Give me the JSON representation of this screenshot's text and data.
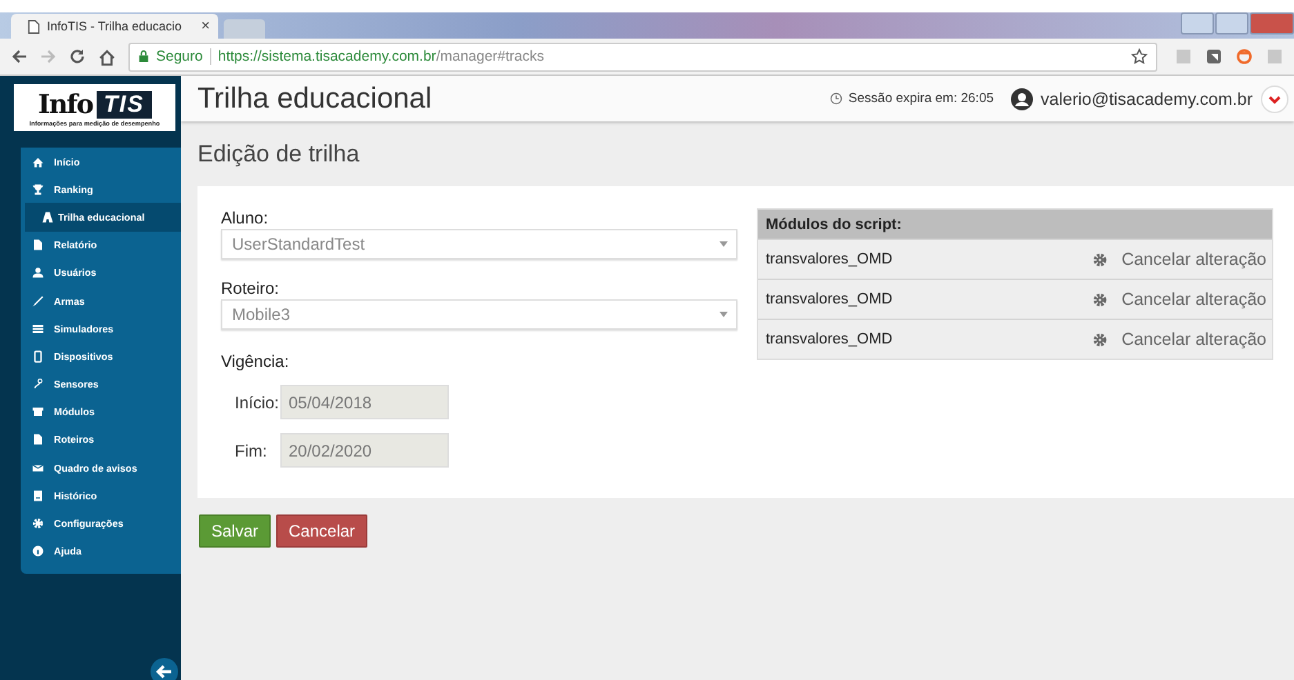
{
  "browser": {
    "tab": {
      "title": "InfoTIS - Trilha educacio",
      "close": "×"
    },
    "security": "Seguro",
    "url": {
      "host": "https://sistema.tisacademy.com.br",
      "path": "/manager#tracks"
    }
  },
  "sidebar": {
    "logo": {
      "word": "Info",
      "mark": "TIS",
      "tagline": "Informações para medição de desempenho"
    },
    "items": [
      {
        "label": "Início",
        "selected": false
      },
      {
        "label": "Ranking",
        "selected": false
      },
      {
        "label": "Trilha educacional",
        "selected": true
      },
      {
        "label": "Relatório",
        "selected": false
      },
      {
        "label": "Usuários",
        "selected": false
      },
      {
        "label": "Armas",
        "selected": false
      },
      {
        "label": "Simuladores",
        "selected": false
      },
      {
        "label": "Dispositivos",
        "selected": false
      },
      {
        "label": "Sensores",
        "selected": false
      },
      {
        "label": "Módulos",
        "selected": false
      },
      {
        "label": "Roteiros",
        "selected": false
      },
      {
        "label": "Quadro de avisos",
        "selected": false
      },
      {
        "label": "Histórico",
        "selected": false
      },
      {
        "label": "Configurações",
        "selected": false
      },
      {
        "label": "Ajuda",
        "selected": false
      }
    ]
  },
  "header": {
    "title": "Trilha educacional",
    "session": "Sessão expira em: 26:05",
    "user": "valerio@tisacademy.com.br"
  },
  "page_title": "Edição de trilha",
  "form": {
    "fields": [
      {
        "kind": "select",
        "label": "Aluno:",
        "value": "UserStandardTest"
      },
      {
        "kind": "select",
        "label": "Roteiro:",
        "value": "Mobile3"
      }
    ],
    "validity": {
      "label": "Vigência:",
      "dates": [
        {
          "label": "Início:",
          "value": "05/04/2018",
          "disabled": true
        },
        {
          "label": "Fim:",
          "value": "20/02/2020",
          "disabled": true
        }
      ]
    }
  },
  "modules": {
    "title": "Módulos do script:",
    "rows": [
      {
        "name": "transvalores_OMD",
        "action": "Cancelar alteração"
      },
      {
        "name": "transvalores_OMD",
        "action": "Cancelar alteração"
      },
      {
        "name": "transvalores_OMD",
        "action": "Cancelar alteração"
      }
    ]
  },
  "buttons": [
    {
      "kind": "save",
      "label": "Salvar"
    },
    {
      "kind": "cancel",
      "label": "Cancelar"
    }
  ]
}
